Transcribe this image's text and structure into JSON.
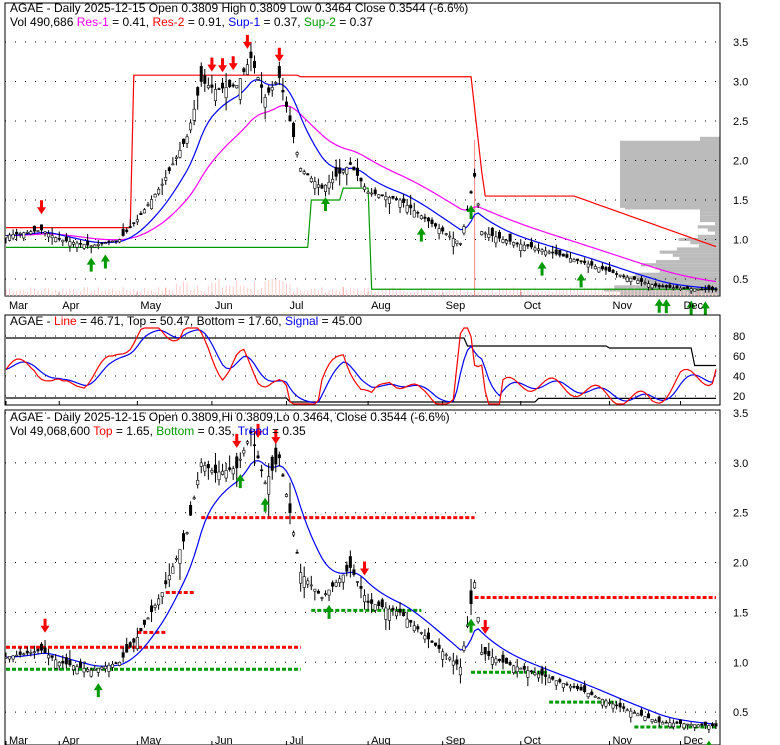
{
  "panel1": {
    "title": "AGAE - Daily 2025-12-15 Open 0.3809  High 0.3809  Low 0.3464  Close 0.3544 (-6.6%)",
    "vol": "Vol 490,686",
    "res1": "Res-1",
    "res1_val": " = 0.41, ",
    "res2": "Res-2",
    "res2_val": " = 0.91, ",
    "sup1": "Sup-1",
    "sup1_val": " = 0.37, ",
    "sup2": "Sup-2",
    "sup2_val": " = 0.37"
  },
  "panel2": {
    "prefix": "AGAE - ",
    "line": "Line",
    "line_val": " = 46.71, Top = 50.47, Bottom = 17.60, ",
    "signal": "Signal",
    "signal_val": " = 45.00"
  },
  "panel3": {
    "title": "AGAE - Daily 2025-12-15 Open 0.3809,Hi 0.3809,Lo 0.3464, Close 0.3544 (-6.6%)",
    "vol": "Vol 49,068,600 ",
    "top": "Top",
    "top_val": " = 1.65, ",
    "bottom": "Bottom",
    "bottom_val": " = 0.35, ",
    "trend": "Trend",
    "trend_val": " = 0.35"
  },
  "colors": {
    "red": "#ff0000",
    "magenta": "#ff00ff",
    "blue": "#0000ff",
    "green": "#009900",
    "gray": "#bbbbbb"
  },
  "chart_data": {
    "type": "line",
    "months": [
      "Mar",
      "Apr",
      "May",
      "Jun",
      "Jul",
      "Aug",
      "Sep",
      "Oct",
      "Nov",
      "Dec"
    ],
    "month_day_index": [
      0,
      15,
      37,
      58,
      79,
      102,
      123,
      145,
      170,
      190
    ],
    "price_ticks": [
      "0.5",
      "1.0",
      "1.5",
      "2.0",
      "2.5",
      "3.0",
      "3.5"
    ],
    "osc_ticks": [
      "20",
      "40",
      "60",
      "80"
    ],
    "close_approx": [
      [
        0,
        1.05
      ],
      [
        10,
        1.12
      ],
      [
        15,
        1.0
      ],
      [
        24,
        0.92
      ],
      [
        32,
        1.0
      ],
      [
        37,
        1.25
      ],
      [
        44,
        1.7
      ],
      [
        51,
        2.3
      ],
      [
        55,
        3.0
      ],
      [
        59,
        2.9
      ],
      [
        65,
        2.95
      ],
      [
        69,
        3.3
      ],
      [
        73,
        2.8
      ],
      [
        77,
        3.05
      ],
      [
        80,
        2.5
      ],
      [
        83,
        1.9
      ],
      [
        89,
        1.65
      ],
      [
        93,
        1.8
      ],
      [
        97,
        1.95
      ],
      [
        102,
        1.6
      ],
      [
        111,
        1.5
      ],
      [
        120,
        1.2
      ],
      [
        128,
        0.95
      ],
      [
        132,
        1.8
      ],
      [
        134,
        1.1
      ],
      [
        140,
        1.0
      ],
      [
        151,
        0.87
      ],
      [
        162,
        0.72
      ],
      [
        173,
        0.55
      ],
      [
        184,
        0.4
      ],
      [
        200,
        0.36
      ]
    ],
    "panel1_down_arrows": [
      10,
      58,
      61,
      64,
      68,
      77
    ],
    "panel1_up_arrows": [
      24,
      28,
      90,
      117,
      131,
      151,
      162,
      184,
      186,
      193,
      197
    ],
    "panel3_down_arrows": [
      11,
      65,
      71,
      76,
      101,
      135
    ],
    "panel3_up_arrows": [
      26,
      66,
      73,
      91,
      131,
      198
    ],
    "res_levels": [
      {
        "from": 0,
        "to": 83,
        "value": 1.15
      },
      {
        "from": 37,
        "to": 45,
        "value": 1.3
      },
      {
        "from": 45,
        "to": 53,
        "value": 1.7
      },
      {
        "from": 55,
        "to": 132,
        "value": 2.45
      },
      {
        "from": 132,
        "to": 200,
        "value": 1.65
      }
    ],
    "sup_levels": [
      {
        "from": 0,
        "to": 83,
        "value": 0.93
      },
      {
        "from": 86,
        "to": 117,
        "value": 1.52
      },
      {
        "from": 131,
        "to": 153,
        "value": 0.9
      },
      {
        "from": 153,
        "to": 172,
        "value": 0.6
      },
      {
        "from": 177,
        "to": 200,
        "value": 0.35
      }
    ],
    "osc_line_final": 46.71,
    "osc_top": 50.47,
    "osc_bottom": 17.6,
    "osc_signal": 45.0
  }
}
